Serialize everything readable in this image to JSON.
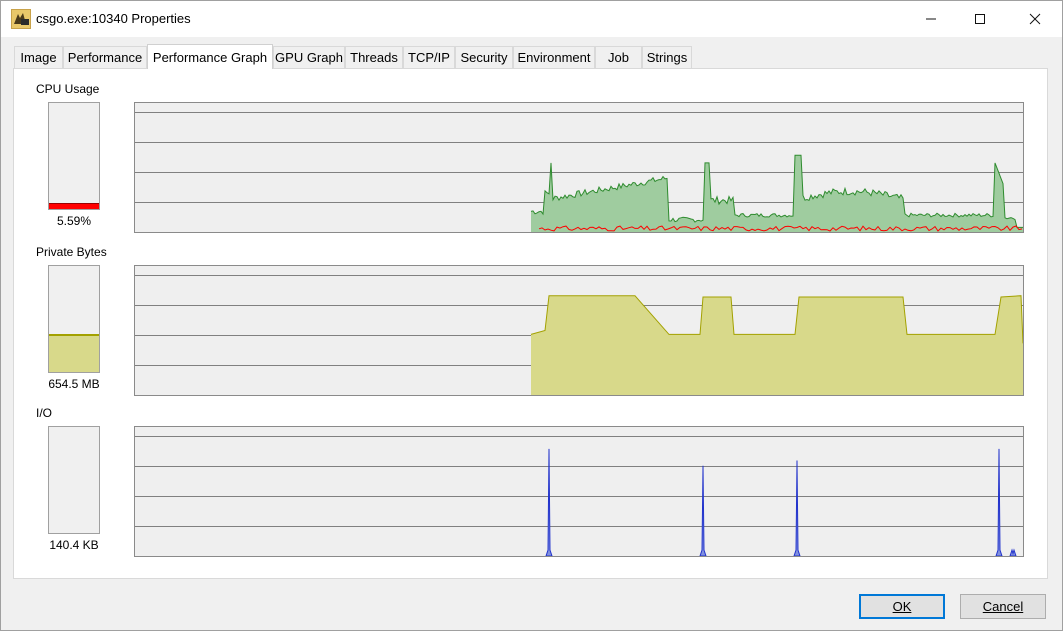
{
  "window": {
    "title": "csgo.exe:10340 Properties",
    "icon": "csgo-app-icon",
    "controls": {
      "minimize": "minimize-icon",
      "maximize": "maximize-icon",
      "close": "close-icon"
    }
  },
  "tabs": [
    {
      "label": "Image"
    },
    {
      "label": "Performance"
    },
    {
      "label": "Performance Graph",
      "active": true
    },
    {
      "label": "GPU Graph"
    },
    {
      "label": "Threads"
    },
    {
      "label": "TCP/IP"
    },
    {
      "label": "Security"
    },
    {
      "label": "Environment"
    },
    {
      "label": "Job"
    },
    {
      "label": "Strings"
    }
  ],
  "sections": {
    "cpu": {
      "label": "CPU Usage",
      "value": "5.59%",
      "fill_fraction": 0.0559
    },
    "private_bytes": {
      "label": "Private Bytes",
      "value": "654.5 MB",
      "fill_fraction": 0.36
    },
    "io": {
      "label": "I/O",
      "value": "140.4  KB",
      "fill_fraction": 0.0
    }
  },
  "colors": {
    "cpu_fill": "#9fcc9f",
    "cpu_line": "#2e8b2e",
    "cpu_kernel": "#ff0000",
    "bytes_fill": "#d8d98a",
    "bytes_line": "#a3a100",
    "io_line": "#2233cc",
    "io_fill": "#8090e0",
    "grid": "#808080",
    "accent": "#0078d7"
  },
  "buttons": {
    "ok": "OK",
    "cancel": "Cancel"
  }
}
